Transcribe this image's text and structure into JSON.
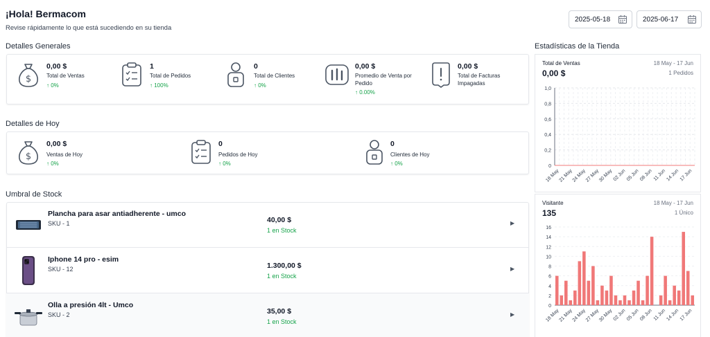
{
  "header": {
    "title": "¡Hola! Bermacom",
    "subtitle": "Revise rápidamente lo que está sucediendo en su tienda",
    "date_from": "2025-05-18",
    "date_to": "2025-06-17"
  },
  "general": {
    "title": "Detalles Generales",
    "stats": [
      {
        "icon": "money-bag-icon",
        "value": "0,00 $",
        "label": "Total de Ventas",
        "pct": "↑ 0%"
      },
      {
        "icon": "clipboard-icon",
        "value": "1",
        "label": "Total de Pedidos",
        "pct": "↑ 100%"
      },
      {
        "icon": "user-badge-icon",
        "value": "0",
        "label": "Total de Clientes",
        "pct": "↑ 0%"
      },
      {
        "icon": "bar-chart-icon",
        "value": "0,00 $",
        "label": "Promedio de Venta por Pedido",
        "pct": "↑ 0.00%"
      },
      {
        "icon": "invoice-alert-icon",
        "value": "0,00 $",
        "label": "Total de Facturas Impagadas",
        "pct": ""
      }
    ]
  },
  "today": {
    "title": "Detalles de Hoy",
    "stats": [
      {
        "icon": "money-bag-icon",
        "value": "0,00 $",
        "label": "Ventas de Hoy",
        "pct": "↑ 0%"
      },
      {
        "icon": "clipboard-icon",
        "value": "0",
        "label": "Pedidos de Hoy",
        "pct": "↑ 0%"
      },
      {
        "icon": "user-badge-icon",
        "value": "0",
        "label": "Clientes de Hoy",
        "pct": "↑ 0%"
      }
    ]
  },
  "stock": {
    "title": "Umbral de Stock",
    "items": [
      {
        "name": "Plancha para asar antiadherente - umco",
        "sku": "SKU - 1",
        "price": "40,00 $",
        "stock": "1 en Stock",
        "thumb": "griddle-image"
      },
      {
        "name": "Iphone 14 pro - esim",
        "sku": "SKU - 12",
        "price": "1.300,00 $",
        "stock": "1 en Stock",
        "thumb": "phone-image"
      },
      {
        "name": "Olla a presión 4lt - Umco",
        "sku": "SKU - 2",
        "price": "35,00 $",
        "stock": "1 en Stock",
        "thumb": "pressure-cooker-image"
      }
    ]
  },
  "store_stats": {
    "title": "Estadísticas de la Tienda",
    "sales": {
      "title": "Total de Ventas",
      "range": "18 May - 17 Jun",
      "value": "0,00 $",
      "sub": "1 Pedidos"
    },
    "visitors": {
      "title": "Visitante",
      "range": "18 May - 17 Jun",
      "value": "135",
      "sub": "1 Único"
    }
  },
  "chart_data": [
    {
      "type": "line",
      "title": "Total de Ventas",
      "x": [
        "18 May",
        "21 May",
        "24 May",
        "27 May",
        "30 May",
        "02 Jun",
        "05 Jun",
        "08 Jun",
        "11 Jun",
        "14 Jun",
        "17 Jun"
      ],
      "y_ticks": [
        "0",
        "0,2",
        "0,4",
        "0,6",
        "0,8",
        "1,0"
      ],
      "ylim": [
        0,
        1
      ],
      "values": [
        0,
        0,
        0,
        0,
        0,
        0,
        0,
        0,
        0,
        0,
        0
      ],
      "grid": true,
      "color": "#e5e7eb"
    },
    {
      "type": "bar",
      "title": "Visitante",
      "x_labels": [
        "18 May",
        "21 May",
        "24 May",
        "27 May",
        "30 May",
        "02 Jun",
        "05 Jun",
        "08 Jun",
        "11 Jun",
        "14 Jun",
        "17 Jun"
      ],
      "y_ticks": [
        "0",
        "2",
        "4",
        "6",
        "8",
        "10",
        "12",
        "14",
        "16"
      ],
      "ylim": [
        0,
        16
      ],
      "values": [
        6,
        2,
        5,
        1,
        3,
        9,
        11,
        5,
        8,
        1,
        4,
        3,
        6,
        2,
        1,
        2,
        1,
        3,
        5,
        1,
        6,
        14,
        0,
        2,
        6,
        1,
        4,
        3,
        15,
        7,
        2
      ],
      "color": "#f07878"
    }
  ]
}
